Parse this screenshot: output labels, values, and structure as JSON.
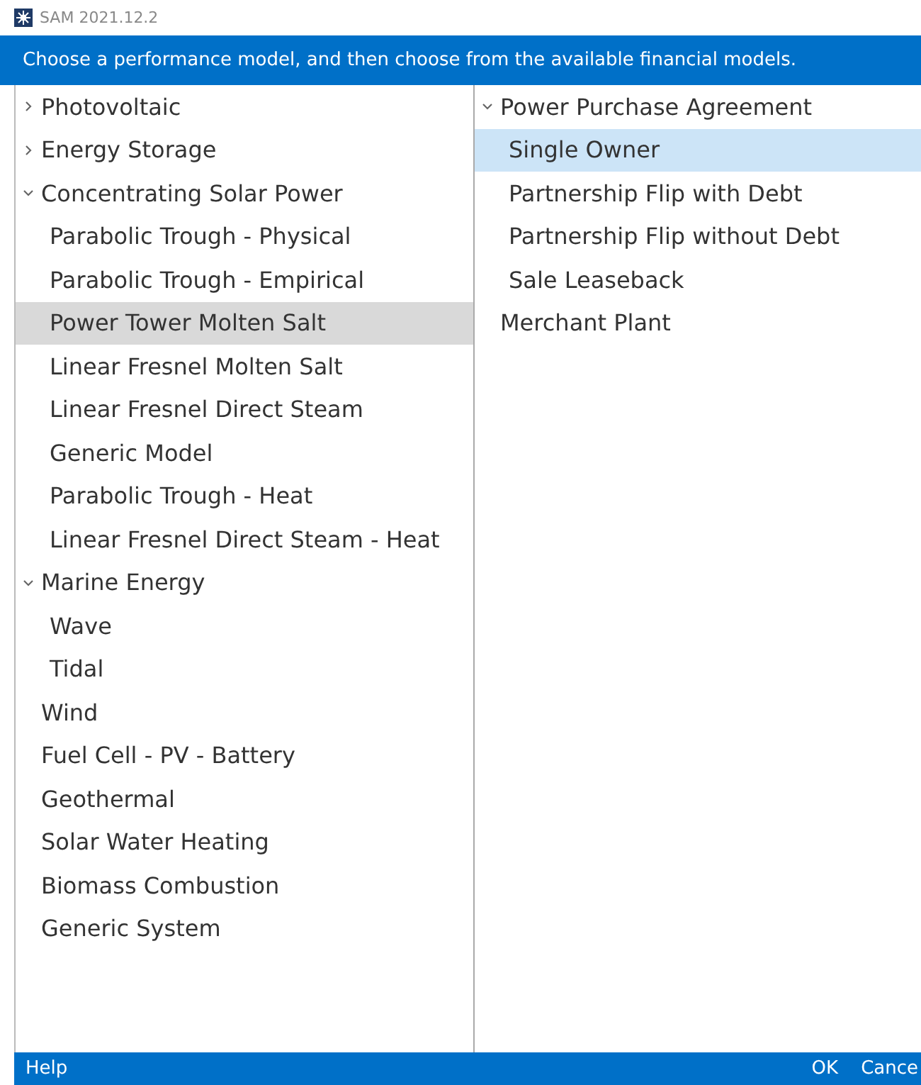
{
  "window": {
    "title": "SAM 2021.12.2"
  },
  "instruction": "Choose a performance model, and then choose from the available financial models.",
  "performance_models": [
    {
      "label": "Photovoltaic",
      "expanded": false,
      "selected": false
    },
    {
      "label": "Energy Storage",
      "expanded": false,
      "selected": false
    },
    {
      "label": "Concentrating Solar Power",
      "expanded": true,
      "selected": false,
      "children": [
        {
          "label": "Parabolic Trough - Physical",
          "selected": false
        },
        {
          "label": "Parabolic Trough - Empirical",
          "selected": false
        },
        {
          "label": "Power Tower Molten Salt",
          "selected": true
        },
        {
          "label": "Linear Fresnel Molten Salt",
          "selected": false
        },
        {
          "label": "Linear Fresnel Direct Steam",
          "selected": false
        },
        {
          "label": "Generic Model",
          "selected": false
        },
        {
          "label": "Parabolic Trough - Heat",
          "selected": false
        },
        {
          "label": "Linear Fresnel Direct Steam - Heat",
          "selected": false
        }
      ]
    },
    {
      "label": "Marine Energy",
      "expanded": true,
      "selected": false,
      "children": [
        {
          "label": "Wave",
          "selected": false
        },
        {
          "label": "Tidal",
          "selected": false
        }
      ]
    },
    {
      "label": "Wind",
      "selected": false
    },
    {
      "label": "Fuel Cell - PV - Battery",
      "selected": false
    },
    {
      "label": "Geothermal",
      "selected": false
    },
    {
      "label": "Solar Water Heating",
      "selected": false
    },
    {
      "label": "Biomass Combustion",
      "selected": false
    },
    {
      "label": "Generic System",
      "selected": false
    }
  ],
  "financial_models": [
    {
      "label": "Power Purchase Agreement",
      "expanded": true,
      "selected": false,
      "children": [
        {
          "label": "Single Owner",
          "selected": true
        },
        {
          "label": "Partnership Flip with Debt",
          "selected": false
        },
        {
          "label": "Partnership Flip without Debt",
          "selected": false
        },
        {
          "label": "Sale Leaseback",
          "selected": false
        }
      ]
    },
    {
      "label": "Merchant Plant",
      "selected": false
    }
  ],
  "footer": {
    "help": "Help",
    "ok": "OK",
    "cancel": "Cance"
  }
}
